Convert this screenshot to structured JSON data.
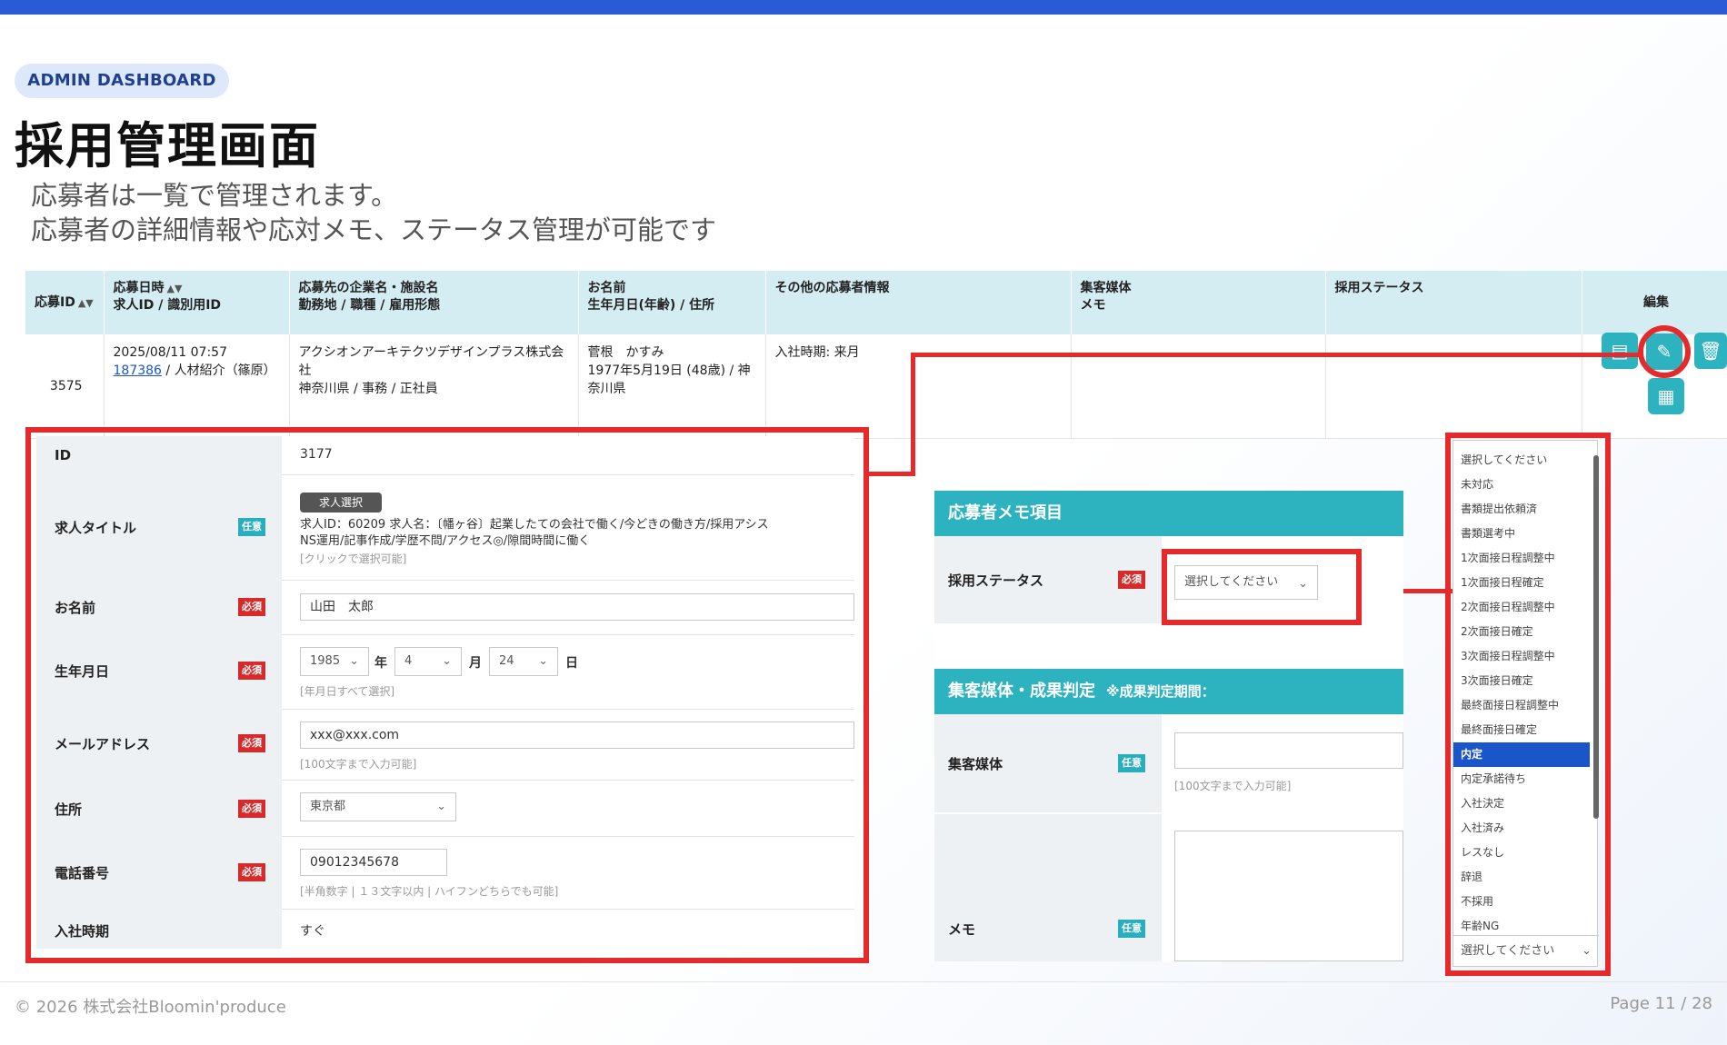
{
  "badge": "ADMIN DASHBOARD",
  "title": "採用管理画面",
  "description": [
    "応募者は一覧で管理されます。",
    "応募者の詳細情報や応対メモ、ステータス管理が可能です"
  ],
  "table": {
    "headers": [
      {
        "l1": "応募ID",
        "l2": ""
      },
      {
        "l1": "応募日時",
        "l2": "求人ID / 識別用ID"
      },
      {
        "l1": "応募先の企業名・施設名",
        "l2": "勤務地 / 職種 / 雇用形態"
      },
      {
        "l1": "お名前",
        "l2": "生年月日(年齢) / 住所"
      },
      {
        "l1": "その他の応募者情報",
        "l2": ""
      },
      {
        "l1": "集客媒体",
        "l2": "メモ"
      },
      {
        "l1": "採用ステータス",
        "l2": ""
      },
      {
        "l1": "編集",
        "l2": ""
      }
    ],
    "row": {
      "id": "3575",
      "date": "2025/08/11 07:57",
      "job_link": "187386",
      "job_rest": " / 人材紹介（篠原）",
      "company": "アクシオンアーキテクツデザインプラス株式会社",
      "location": "神奈川県 / 事務 / 正社員",
      "name": "菅根　かすみ",
      "birth": "1977年5月19日 (48歳) / 神奈川県",
      "other": "入社時期: 来月"
    },
    "icons": {
      "doc": "document-icon",
      "edit": "pencil-icon",
      "delete": "trash-icon",
      "pdf": "pdf-icon"
    }
  },
  "form": {
    "id_label": "ID",
    "id_value": "3177",
    "job_label": "求人タイトル",
    "job_chip": "求人選択",
    "job_text1": "求人ID：60209 求人名：〔幡ヶ谷〕起業したての会社で働く/今どきの働き方/採用アシス",
    "job_text2": "NS運用/記事作成/学歴不問/アクセス◎/隙間時間に働く",
    "job_hint": "[クリックで選択可能]",
    "name_label": "お名前",
    "name_value": "山田　太郎",
    "birth_label": "生年月日",
    "birth_year": "1985",
    "birth_month": "4",
    "birth_day": "24",
    "u_year": "年",
    "u_month": "月",
    "u_day": "日",
    "birth_hint": "[年月日すべて選択]",
    "email_label": "メールアドレス",
    "email_value": "xxx@xxx.com",
    "email_hint": "[100文字まで入力可能]",
    "addr_label": "住所",
    "addr_value": "東京都",
    "tel_label": "電話番号",
    "tel_value": "09012345678",
    "tel_hint": "[半角数字 | １３文字以内 | ハイフンどちらでも可能]",
    "start_label": "入社時期",
    "start_value": "すぐ",
    "tag_required": "必須",
    "tag_optional": "任意"
  },
  "memo": {
    "header1": "応募者メモ項目",
    "status_label": "採用ステータス",
    "status_placeholder": "選択してください",
    "header2": "集客媒体・成果判定",
    "header2_note": "※成果判定期間：",
    "media_label": "集客媒体",
    "media_hint": "[100文字まで入力可能]",
    "memo_label": "メモ"
  },
  "dropdown": {
    "items": [
      "選択してください",
      "未対応",
      "書類提出依頼済",
      "書類選考中",
      "1次面接日程調整中",
      "1次面接日程確定",
      "2次面接日程調整中",
      "2次面接日確定",
      "3次面接日程調整中",
      "3次面接日確定",
      "最終面接日程調整中",
      "最終面接日確定",
      "内定",
      "内定承諾待ち",
      "入社決定",
      "入社済み",
      "レスなし",
      "辞退",
      "不採用",
      "年齢NG"
    ],
    "selected": "内定",
    "footer": "選択してください"
  },
  "footer": {
    "copyright": "© 2026 株式会社Bloomin'produce",
    "page": "Page 11 / 28"
  },
  "colors": {
    "accent": "#2a5bd7",
    "highlight": "#e42a2a",
    "teal": "#2db2c0",
    "selected": "#1a55c9"
  }
}
